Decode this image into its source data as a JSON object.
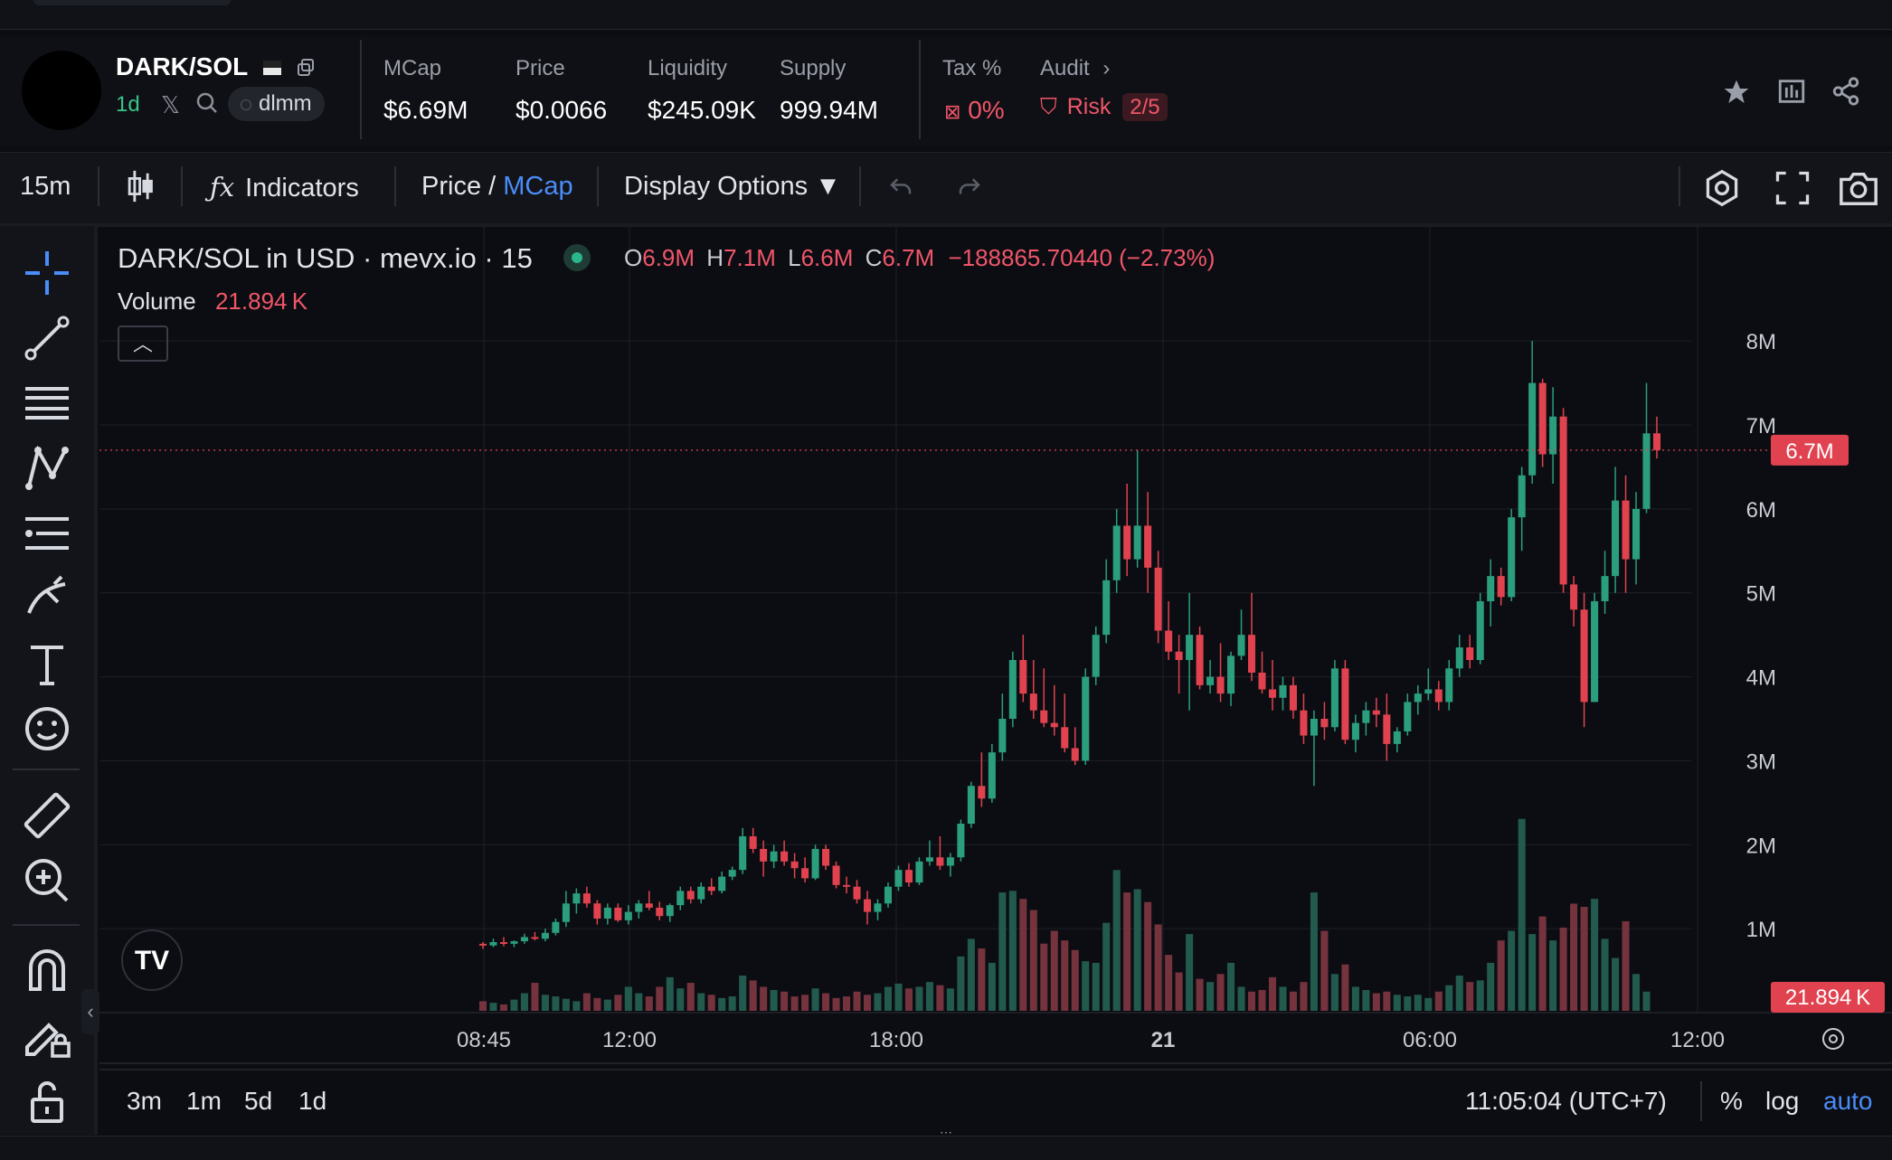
{
  "token": {
    "pair": "DARK/SOL",
    "age": "1d",
    "dex_tag": "dlmm"
  },
  "stats": [
    {
      "label": "MCap",
      "value": "$6.69M"
    },
    {
      "label": "Price",
      "value": "$0.0066"
    },
    {
      "label": "Liquidity",
      "value": "$245.09K"
    },
    {
      "label": "Supply",
      "value": "999.94M"
    }
  ],
  "tax": {
    "label": "Tax %",
    "value": "0%"
  },
  "audit": {
    "label": "Audit",
    "risk_label": "Risk",
    "risk_value": "2/5"
  },
  "toolbar": {
    "interval": "15m",
    "indicators": "Indicators",
    "price": "Price",
    "slash": "/",
    "mcap": "MCap",
    "display_options": "Display Options"
  },
  "legend": {
    "title": "DARK/SOL in USD · mevx.io · 15",
    "o_label": "O",
    "o": "6.9M",
    "h_label": "H",
    "h": "7.1M",
    "l_label": "L",
    "l": "6.6M",
    "c_label": "C",
    "c": "6.7M",
    "change": "−188865.70440 (−2.73%)",
    "volume_label": "Volume",
    "volume": "21.894 K"
  },
  "chart_data": {
    "type": "candlestick",
    "title": "DARK/SOL in USD · mevx.io · 15",
    "y_ticks": [
      "8M",
      "7M",
      "6M",
      "5M",
      "4M",
      "3M",
      "2M",
      "1M"
    ],
    "y_range": [
      0,
      8.4
    ],
    "x_ticks": [
      "08:45",
      "12:00",
      "18:00",
      "21",
      "06:00",
      "12:00"
    ],
    "last_price_label": "6.7M",
    "last_volume_label": "21.894 K",
    "grid": true,
    "candles_ohlc_millions": [
      [
        0.82,
        0.84,
        0.76,
        0.8
      ],
      [
        0.8,
        0.88,
        0.78,
        0.84
      ],
      [
        0.84,
        0.9,
        0.79,
        0.82
      ],
      [
        0.82,
        0.86,
        0.78,
        0.85
      ],
      [
        0.85,
        0.94,
        0.82,
        0.9
      ],
      [
        0.9,
        0.96,
        0.86,
        0.88
      ],
      [
        0.88,
        1.0,
        0.85,
        0.95
      ],
      [
        0.95,
        1.12,
        0.92,
        1.08
      ],
      [
        1.08,
        1.45,
        1.02,
        1.3
      ],
      [
        1.3,
        1.48,
        1.18,
        1.42
      ],
      [
        1.42,
        1.5,
        1.25,
        1.3
      ],
      [
        1.3,
        1.34,
        1.05,
        1.12
      ],
      [
        1.12,
        1.3,
        1.05,
        1.25
      ],
      [
        1.25,
        1.3,
        1.08,
        1.1
      ],
      [
        1.1,
        1.28,
        1.05,
        1.2
      ],
      [
        1.2,
        1.34,
        1.12,
        1.3
      ],
      [
        1.3,
        1.45,
        1.22,
        1.25
      ],
      [
        1.25,
        1.32,
        1.1,
        1.15
      ],
      [
        1.15,
        1.3,
        1.08,
        1.28
      ],
      [
        1.28,
        1.5,
        1.22,
        1.45
      ],
      [
        1.45,
        1.5,
        1.3,
        1.35
      ],
      [
        1.35,
        1.55,
        1.3,
        1.5
      ],
      [
        1.5,
        1.6,
        1.4,
        1.45
      ],
      [
        1.45,
        1.68,
        1.42,
        1.62
      ],
      [
        1.62,
        1.74,
        1.58,
        1.7
      ],
      [
        1.7,
        2.2,
        1.65,
        2.1
      ],
      [
        2.1,
        2.2,
        1.9,
        1.95
      ],
      [
        1.95,
        2.05,
        1.62,
        1.8
      ],
      [
        1.8,
        2.0,
        1.72,
        1.92
      ],
      [
        1.92,
        2.05,
        1.75,
        1.8
      ],
      [
        1.8,
        1.9,
        1.6,
        1.72
      ],
      [
        1.72,
        1.85,
        1.55,
        1.6
      ],
      [
        1.6,
        2.0,
        1.58,
        1.95
      ],
      [
        1.95,
        2.0,
        1.7,
        1.75
      ],
      [
        1.75,
        1.8,
        1.48,
        1.52
      ],
      [
        1.52,
        1.62,
        1.42,
        1.5
      ],
      [
        1.5,
        1.58,
        1.3,
        1.35
      ],
      [
        1.35,
        1.45,
        1.05,
        1.2
      ],
      [
        1.2,
        1.35,
        1.1,
        1.3
      ],
      [
        1.3,
        1.55,
        1.25,
        1.5
      ],
      [
        1.5,
        1.75,
        1.45,
        1.7
      ],
      [
        1.7,
        1.78,
        1.5,
        1.55
      ],
      [
        1.55,
        1.85,
        1.52,
        1.8
      ],
      [
        1.8,
        2.05,
        1.75,
        1.85
      ],
      [
        1.85,
        2.1,
        1.7,
        1.75
      ],
      [
        1.75,
        1.9,
        1.62,
        1.85
      ],
      [
        1.85,
        2.3,
        1.8,
        2.25
      ],
      [
        2.25,
        2.75,
        2.2,
        2.7
      ],
      [
        2.7,
        3.1,
        2.45,
        2.55
      ],
      [
        2.55,
        3.2,
        2.5,
        3.1
      ],
      [
        3.1,
        3.8,
        3.0,
        3.5
      ],
      [
        3.5,
        4.3,
        3.4,
        4.2
      ],
      [
        4.2,
        4.5,
        3.7,
        3.8
      ],
      [
        3.8,
        4.2,
        3.5,
        3.6
      ],
      [
        3.6,
        4.1,
        3.4,
        3.45
      ],
      [
        3.45,
        3.9,
        3.3,
        3.4
      ],
      [
        3.4,
        3.8,
        3.1,
        3.15
      ],
      [
        3.15,
        3.4,
        2.95,
        3.0
      ],
      [
        3.0,
        4.1,
        2.95,
        4.0
      ],
      [
        4.0,
        4.6,
        3.9,
        4.5
      ],
      [
        4.5,
        5.4,
        4.4,
        5.15
      ],
      [
        5.15,
        6.0,
        5.0,
        5.8
      ],
      [
        5.8,
        6.3,
        5.2,
        5.4
      ],
      [
        5.4,
        6.7,
        5.3,
        5.8
      ],
      [
        5.8,
        6.2,
        5.0,
        5.3
      ],
      [
        5.3,
        5.5,
        4.4,
        4.55
      ],
      [
        4.55,
        4.9,
        4.2,
        4.3
      ],
      [
        4.3,
        4.5,
        3.8,
        4.2
      ],
      [
        4.2,
        5.0,
        3.6,
        4.5
      ],
      [
        4.5,
        4.6,
        3.85,
        3.9
      ],
      [
        3.9,
        4.2,
        3.8,
        4.0
      ],
      [
        4.0,
        4.4,
        3.7,
        3.8
      ],
      [
        3.8,
        4.3,
        3.65,
        4.25
      ],
      [
        4.25,
        4.8,
        4.2,
        4.5
      ],
      [
        4.5,
        5.0,
        3.95,
        4.05
      ],
      [
        4.05,
        4.3,
        3.8,
        3.85
      ],
      [
        3.85,
        4.2,
        3.6,
        3.75
      ],
      [
        3.75,
        4.0,
        3.6,
        3.9
      ],
      [
        3.9,
        4.0,
        3.5,
        3.6
      ],
      [
        3.6,
        3.8,
        3.2,
        3.3
      ],
      [
        3.3,
        3.6,
        2.7,
        3.5
      ],
      [
        3.5,
        3.7,
        3.25,
        3.4
      ],
      [
        3.4,
        4.2,
        3.35,
        4.1
      ],
      [
        4.1,
        4.2,
        3.2,
        3.25
      ],
      [
        3.25,
        3.55,
        3.1,
        3.45
      ],
      [
        3.45,
        3.7,
        3.3,
        3.6
      ],
      [
        3.6,
        3.75,
        3.4,
        3.55
      ],
      [
        3.55,
        3.8,
        3.0,
        3.2
      ],
      [
        3.2,
        3.4,
        3.1,
        3.35
      ],
      [
        3.35,
        3.8,
        3.3,
        3.7
      ],
      [
        3.7,
        3.9,
        3.55,
        3.8
      ],
      [
        3.8,
        4.1,
        3.72,
        3.85
      ],
      [
        3.85,
        3.95,
        3.6,
        3.7
      ],
      [
        3.7,
        4.2,
        3.6,
        4.1
      ],
      [
        4.1,
        4.5,
        4.0,
        4.35
      ],
      [
        4.35,
        4.5,
        4.1,
        4.2
      ],
      [
        4.2,
        5.0,
        4.15,
        4.9
      ],
      [
        4.9,
        5.4,
        4.6,
        5.2
      ],
      [
        5.2,
        5.3,
        4.85,
        4.95
      ],
      [
        4.95,
        6.0,
        4.9,
        5.9
      ],
      [
        5.9,
        6.5,
        5.5,
        6.4
      ],
      [
        6.4,
        8.0,
        6.3,
        7.5
      ],
      [
        7.5,
        7.55,
        6.5,
        6.65
      ],
      [
        6.65,
        7.45,
        6.3,
        7.1
      ],
      [
        7.1,
        7.2,
        5.0,
        5.1
      ],
      [
        5.1,
        5.2,
        4.6,
        4.8
      ],
      [
        4.8,
        5.0,
        3.4,
        3.7
      ],
      [
        3.7,
        5.0,
        3.7,
        4.9
      ],
      [
        4.9,
        5.5,
        4.75,
        5.2
      ],
      [
        5.2,
        6.5,
        5.0,
        6.1
      ],
      [
        6.1,
        6.4,
        5.0,
        5.4
      ],
      [
        5.4,
        6.2,
        5.1,
        6.0
      ],
      [
        6.0,
        7.5,
        5.95,
        6.9
      ],
      [
        6.9,
        7.1,
        6.6,
        6.7
      ]
    ],
    "volume_thousands_approx": [
      12,
      10,
      8,
      14,
      22,
      35,
      20,
      18,
      15,
      12,
      22,
      16,
      14,
      20,
      30,
      22,
      18,
      30,
      42,
      28,
      35,
      22,
      20,
      16,
      18,
      44,
      38,
      30,
      26,
      24,
      18,
      20,
      28,
      22,
      16,
      18,
      24,
      20,
      22,
      30,
      34,
      28,
      30,
      36,
      32,
      28,
      68,
      90,
      78,
      60,
      148,
      150,
      140,
      126,
      84,
      100,
      88,
      76,
      62,
      60,
      110,
      176,
      148,
      152,
      136,
      108,
      70,
      48,
      96,
      40,
      36,
      46,
      60,
      30,
      24,
      26,
      42,
      30,
      24,
      36,
      148,
      100,
      46,
      58,
      30,
      26,
      22,
      24,
      20,
      18,
      20,
      16,
      24,
      32,
      44,
      36,
      38,
      60,
      88,
      100,
      240,
      96,
      118,
      88,
      104,
      134,
      130,
      140,
      90,
      66,
      112,
      46,
      24
    ]
  },
  "bottom": {
    "ranges": [
      "3m",
      "1m",
      "5d",
      "1d"
    ],
    "time": "11:05:04 (UTC+7)",
    "percent": "%",
    "log": "log",
    "auto": "auto"
  },
  "colors": {
    "up": "#2b9e7e",
    "down": "#e0434f",
    "accent": "#4a8df8"
  }
}
